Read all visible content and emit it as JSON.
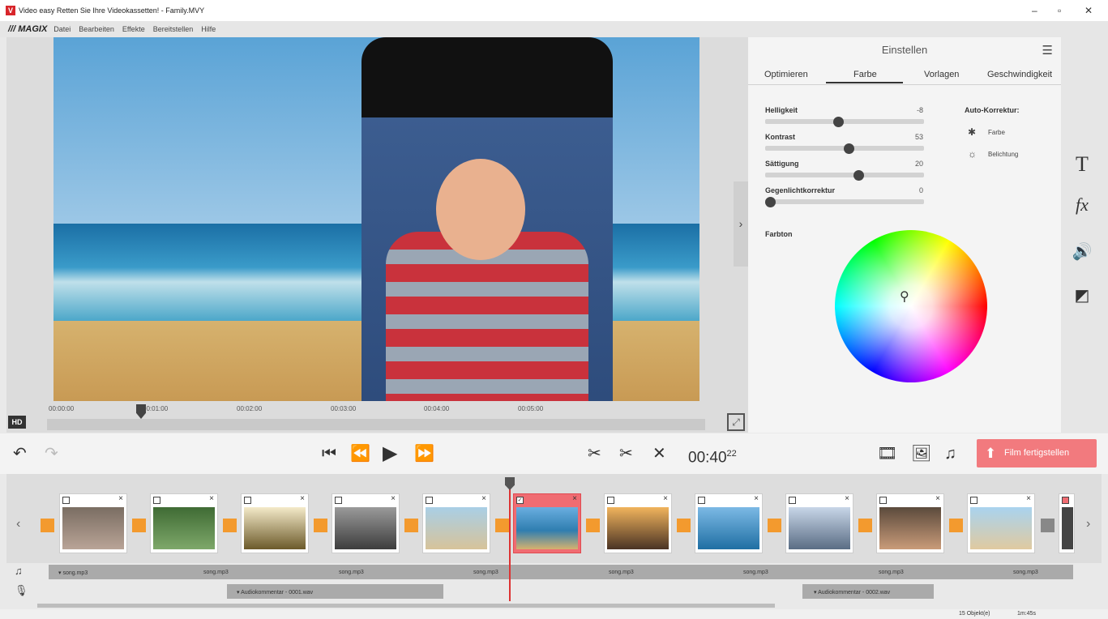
{
  "window": {
    "title": "Video easy Retten Sie Ihre Videokassetten! - Family.MVY",
    "logo_letter": "V",
    "controls": [
      "–",
      "▫",
      "✕"
    ]
  },
  "menu": {
    "brand": "/// MAGIX",
    "items": [
      "Datei",
      "Bearbeiten",
      "Effekte",
      "Bereitstellen",
      "Hilfe"
    ]
  },
  "preview": {
    "hd_label": "HD",
    "timeline_ticks": [
      "00:00:00",
      "00:01:00",
      "00:02:00",
      "00:03:00",
      "00:04:00",
      "00:05:00"
    ]
  },
  "settings": {
    "title": "Einstellen",
    "tabs": [
      "Optimieren",
      "Farbe",
      "Vorlagen",
      "Geschwindigkeit"
    ],
    "active_tab": "Farbe",
    "sliders": [
      {
        "label": "Helligkeit",
        "value": "-8"
      },
      {
        "label": "Kontrast",
        "value": "53"
      },
      {
        "label": "Sättigung",
        "value": "20"
      },
      {
        "label": "Gegenlichtkorrektur",
        "value": "0"
      }
    ],
    "auto_title": "Auto-Korrektur:",
    "auto_items": [
      "Farbe",
      "Belichtung"
    ],
    "hue_label": "Farbton"
  },
  "sidebar_icons": [
    "text-icon",
    "fx-icon",
    "audio-icon",
    "contrast-icon"
  ],
  "controls": {
    "timecode": "00:40",
    "timecode_frames": "22",
    "finish_label": "Film fertigstellen"
  },
  "audio": {
    "music_file": "song.mp3",
    "comment1": "Audiokommentar - 0001.wav",
    "comment2": "Audiokommentar - 0002.wav"
  },
  "status": {
    "objects": "15 Objekt(e)",
    "duration": "1m:45s"
  },
  "colors": {
    "accent": "#f27a7e",
    "transition": "#f39a2e"
  }
}
